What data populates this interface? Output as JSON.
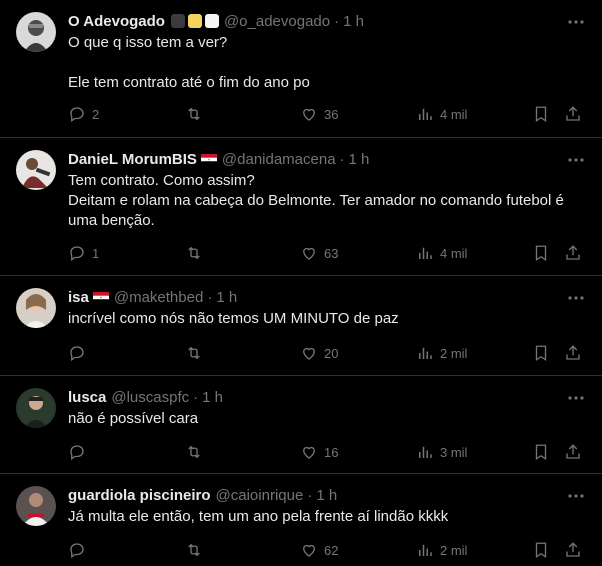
{
  "colors": {
    "background": "#000000",
    "text": "#e7e9ea",
    "muted": "#71767b",
    "divider": "#2f3336"
  },
  "tweets": [
    {
      "name": "O Adevogado",
      "badges": [
        "#3a3a3f",
        "#f4d35e",
        "#f5f5f5"
      ],
      "handle": "@o_adevogado",
      "sep": "·",
      "time": "1 h",
      "text": "O que q isso tem a ver?\n\nEle tem contrato até o fim do ano po",
      "replies": "2",
      "retweets": "",
      "likes": "36",
      "views": "4 mil"
    },
    {
      "name": "DanieL MorumBIS",
      "flag": "egypt-flag",
      "handle": "@danidamacena",
      "sep": "·",
      "time": "1 h",
      "text": "Tem contrato. Como assim?\nDeitam e rolam na cabeça do Belmonte. Ter amador no comando futebol é uma benção.",
      "replies": "1",
      "retweets": "",
      "likes": "63",
      "views": "4 mil"
    },
    {
      "name": "isa",
      "flag": "egypt-flag",
      "handle": "@makethbed",
      "sep": "·",
      "time": "1 h",
      "text": "incrível como nós não temos UM MINUTO de paz",
      "replies": "",
      "retweets": "",
      "likes": "20",
      "views": "2 mil"
    },
    {
      "name": "lusca",
      "handle": "@luscaspfc",
      "sep": "·",
      "time": "1 h",
      "text": "não é possível cara",
      "replies": "",
      "retweets": "",
      "likes": "16",
      "views": "3 mil"
    },
    {
      "name": "guardiola piscineiro",
      "handle": "@caioinrique",
      "sep": "·",
      "time": "1 h",
      "text": "Já multa ele então, tem um ano pela frente aí lindão kkkk",
      "replies": "",
      "retweets": "",
      "likes": "62",
      "views": "2 mil"
    }
  ]
}
